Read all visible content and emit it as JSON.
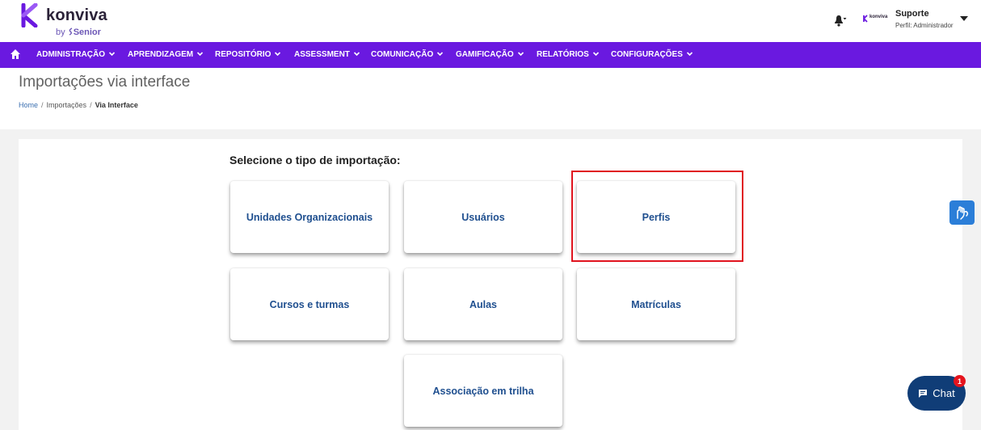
{
  "brand": {
    "name": "konviva",
    "by": "by",
    "company": "Senior",
    "accent": "#6a19e0"
  },
  "user": {
    "logo_text": "konviva",
    "name": "Suporte",
    "profile": "Perfil: Administrador"
  },
  "nav": {
    "items": [
      {
        "label": "ADMINISTRAÇÃO"
      },
      {
        "label": "APRENDIZAGEM"
      },
      {
        "label": "REPOSITÓRIO"
      },
      {
        "label": "ASSESSMENT"
      },
      {
        "label": "COMUNICAÇÃO"
      },
      {
        "label": "GAMIFICAÇÃO"
      },
      {
        "label": "RELATÓRIOS"
      },
      {
        "label": "CONFIGURAÇÕES"
      }
    ]
  },
  "page": {
    "title": "Importações via interface",
    "breadcrumb": {
      "home": "Home",
      "sep": "/",
      "section": "Importações",
      "current": "Via Interface"
    }
  },
  "import": {
    "prompt": "Selecione o tipo de importação:",
    "options": [
      {
        "label": "Unidades Organizacionais"
      },
      {
        "label": "Usuários"
      },
      {
        "label": "Perfis",
        "highlighted": true
      },
      {
        "label": "Cursos e turmas"
      },
      {
        "label": "Aulas"
      },
      {
        "label": "Matrículas"
      },
      {
        "label": "Associação em trilha"
      }
    ]
  },
  "chat": {
    "label": "Chat",
    "badge": "1"
  }
}
